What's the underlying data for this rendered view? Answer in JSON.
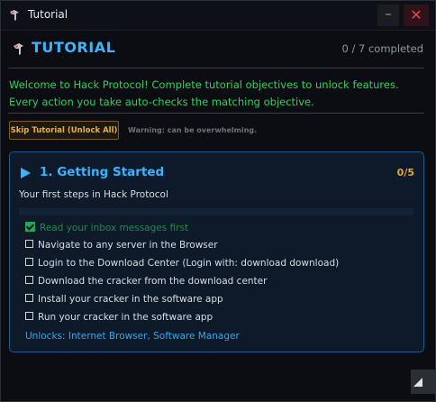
{
  "window": {
    "title": "Tutorial",
    "minimize_label": "–",
    "close_label": "✕"
  },
  "header": {
    "title": "TUTORIAL",
    "progress": "0 / 7 completed"
  },
  "intro": {
    "line1": "Welcome to Hack Protocol! Complete tutorial objectives to unlock features.",
    "line2": "Every action you take auto-checks the matching objective."
  },
  "skip": {
    "button_label": "Skip Tutorial (Unlock All)",
    "warning": "Warning: can be overwhelming."
  },
  "section": {
    "title": "1. Getting Started",
    "count": "0/5",
    "subtitle": "Your first steps in Hack Protocol",
    "objectives": [
      {
        "label": "Read your inbox messages first",
        "checked": true
      },
      {
        "label": "Navigate to any server in the Browser",
        "checked": false
      },
      {
        "label": "Login to the Download Center (Login with: download download)",
        "checked": false
      },
      {
        "label": "Download the cracker from the download center",
        "checked": false
      },
      {
        "label": "Install your cracker in the software app",
        "checked": false
      },
      {
        "label": "Run your cracker in the software app",
        "checked": false
      }
    ],
    "unlocks": "Unlocks: Internet Browser, Software Manager"
  },
  "colors": {
    "accent": "#39b5ff",
    "success": "#31d15c",
    "warning": "#e3b247",
    "close": "#e34848"
  },
  "icons": [
    "app-icon",
    "tutorial-icon",
    "resize-handle-icon"
  ]
}
